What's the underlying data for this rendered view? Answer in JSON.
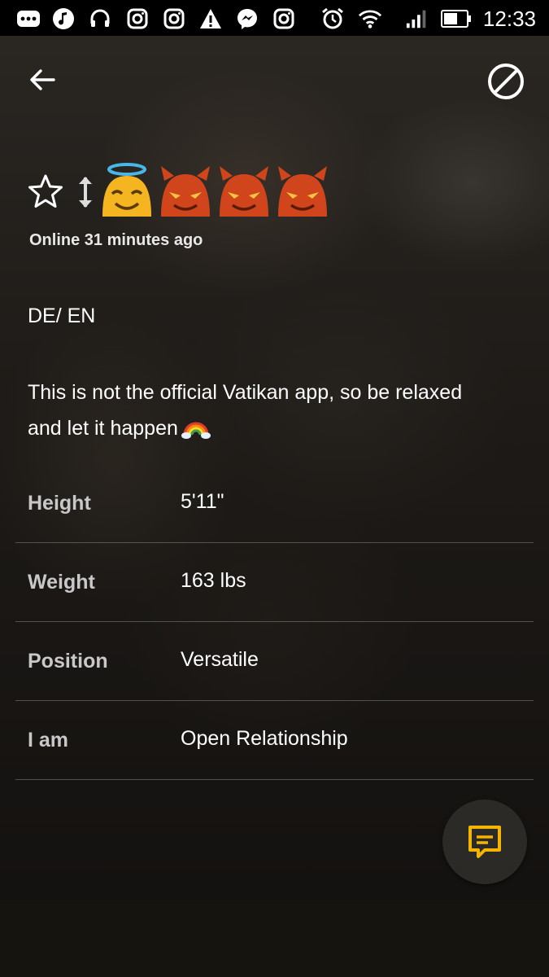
{
  "status_bar": {
    "time": "12:33",
    "icons": [
      "more-icon",
      "music-icon",
      "headphones-icon",
      "instagram-icon",
      "instagram-icon",
      "warning-icon",
      "messenger-icon",
      "instagram-icon",
      "alarm-icon",
      "wifi-icon",
      "signal-icon",
      "battery-icon"
    ]
  },
  "header": {
    "back_icon": "arrow-left-icon",
    "block_icon": "block-icon"
  },
  "profile": {
    "badges": [
      "star-icon",
      "up-down-arrow-icon",
      "angel-emoji",
      "devil-emoji",
      "devil-emoji",
      "devil-emoji"
    ],
    "online_status": "Online 31 minutes ago",
    "languages": "DE/ EN",
    "about_line1": "This is not the official Vatikan app, so be relaxed",
    "about_line2": "and let it happen",
    "stats": [
      {
        "label": "Height",
        "value": "5'11\""
      },
      {
        "label": "Weight",
        "value": "163 lbs"
      },
      {
        "label": "Position",
        "value": "Versatile"
      },
      {
        "label": "I am",
        "value": "Open Relationship"
      }
    ]
  },
  "chat_button": {
    "icon": "chat-icon",
    "accent": "#f5b400"
  }
}
